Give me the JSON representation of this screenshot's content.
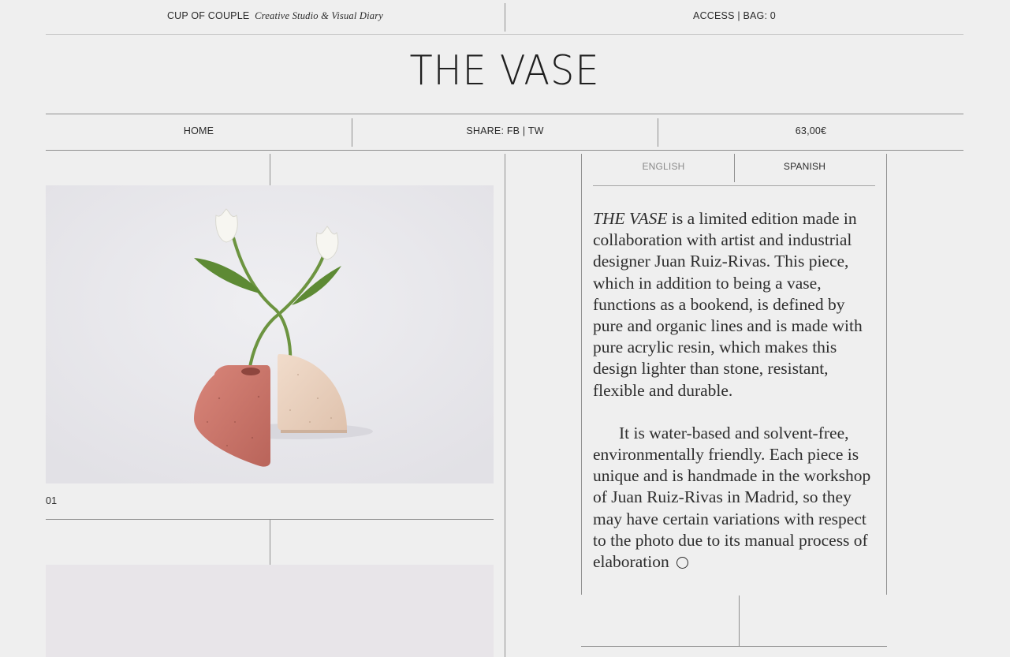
{
  "topbar": {
    "brand_name": "CUP OF COUPLE",
    "brand_tagline": "Creative Studio & Visual Diary",
    "access_label": "ACCESS",
    "separator": "|",
    "bag_label": "BAG: 0"
  },
  "product": {
    "title": "THE VASE",
    "price": "63,00€"
  },
  "nav": {
    "home_label": "HOME",
    "share_prefix": "SHARE:",
    "share_fb": "FB",
    "share_separator": "|",
    "share_tw": "TW"
  },
  "language_tabs": [
    {
      "label": "ENGLISH",
      "active": false
    },
    {
      "label": "SPANISH",
      "active": true
    }
  ],
  "description": {
    "p1_italic": "THE VASE",
    "p1_rest": " is a limited edition made in collaboration with artist and industrial designer Juan Ruiz-Rivas. This piece, which in addition to being a vase, functions as a bookend, is defined by pure and organic lines and is made with pure acrylic resin, which makes this design lighter than stone, resistant, flexible and durable.",
    "p2": "It is water-based and solvent-free, environmentally friendly. Each piece is unique and is handmade in the workshop of Juan Ruiz-Rivas in Madrid, so they may have certain variations with respect to the photo due to its manual process of elaboration",
    "end_icon": "circle-icon"
  },
  "gallery": [
    {
      "caption": "01",
      "subject": "two white tulips in terracotta and beige half-round vases"
    },
    {
      "caption": "",
      "subject": "second product photo (cropped)"
    }
  ],
  "colors": {
    "background": "#efefef",
    "text": "#2a2a2a",
    "rule": "#8f8f8f",
    "terracotta": "#c97466",
    "sand": "#e6cdb8"
  }
}
